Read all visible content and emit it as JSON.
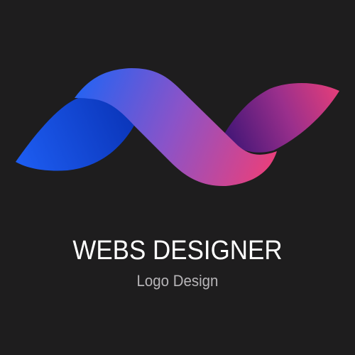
{
  "brand": {
    "name": "WEBS DESIGNER",
    "tagline": "Logo Design"
  },
  "colors": {
    "background": "#1e1d1e",
    "brand_text": "#ffffff",
    "tagline_text": "#b7b5b8",
    "gradient_blue": "#2563f2",
    "gradient_violet": "#8b53c8",
    "gradient_pink": "#e6407e",
    "gradient_dark_purple": "#4a1a7a"
  },
  "logo": {
    "icon": "ribbon-wave-logo-icon"
  }
}
